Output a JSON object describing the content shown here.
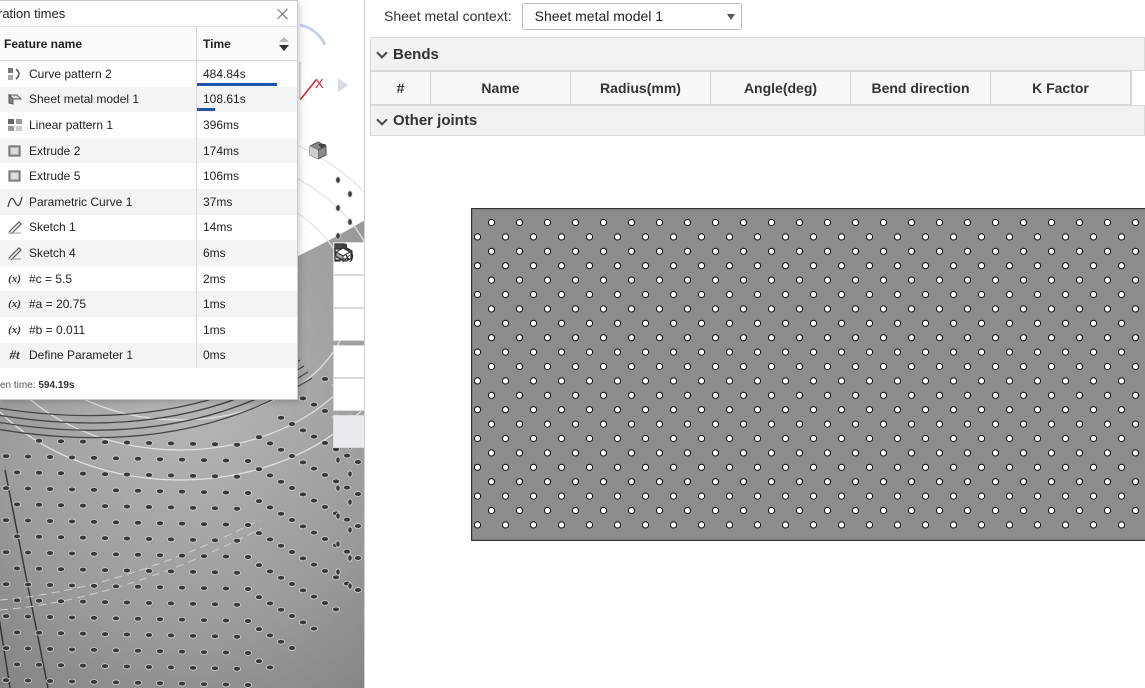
{
  "regen_panel": {
    "title": "ration times",
    "columns": {
      "name": "Feature name",
      "time": "Time"
    },
    "rows": [
      {
        "name": "Curve pattern 2",
        "time": "484.84s",
        "icon": "curve-pattern-icon",
        "bar_fraction": 1.0
      },
      {
        "name": "Sheet metal model 1",
        "time": "108.61s",
        "icon": "sheet-metal-icon",
        "bar_fraction": 0.224
      },
      {
        "name": "Linear pattern 1",
        "time": "396ms",
        "icon": "linear-pattern-icon"
      },
      {
        "name": "Extrude 2",
        "time": "174ms",
        "icon": "extrude-icon"
      },
      {
        "name": "Extrude 5",
        "time": "106ms",
        "icon": "extrude-icon"
      },
      {
        "name": "Parametric Curve 1",
        "time": "37ms",
        "icon": "parametric-curve-icon"
      },
      {
        "name": "Sketch 1",
        "time": "14ms",
        "icon": "sketch-icon"
      },
      {
        "name": "Sketch 4",
        "time": "6ms",
        "icon": "sketch-icon"
      },
      {
        "name": "#c = 5.5",
        "time": "2ms",
        "icon": "variable-icon"
      },
      {
        "name": "#a = 20.75",
        "time": "1ms",
        "icon": "variable-icon"
      },
      {
        "name": "#b = 0.011",
        "time": "1ms",
        "icon": "variable-icon"
      },
      {
        "name": "Define Parameter 1",
        "time": "0ms",
        "icon": "parameter-icon"
      }
    ],
    "footer_label": "en time: ",
    "footer_value": "594.19s"
  },
  "viewport": {
    "axis_label": "X",
    "toolbar_icons": [
      "sheet-metal-tool-icon",
      "view-cube-tool-icon",
      "section-view-icon",
      "feature-table-icon",
      "variable-table-icon",
      "render-icon"
    ]
  },
  "sheet_metal": {
    "context_label": "Sheet metal context:",
    "context_value": "Sheet metal model 1",
    "bends_title": "Bends",
    "bends_columns": [
      "#",
      "Name",
      "Radius(mm)",
      "Angle(deg)",
      "Bend direction",
      "K Factor"
    ],
    "other_joints_title": "Other joints"
  },
  "colors": {
    "accent_bar": "#1f56a8",
    "flat_fill": "#8c8c8c",
    "axis_x": "#d9232e"
  }
}
